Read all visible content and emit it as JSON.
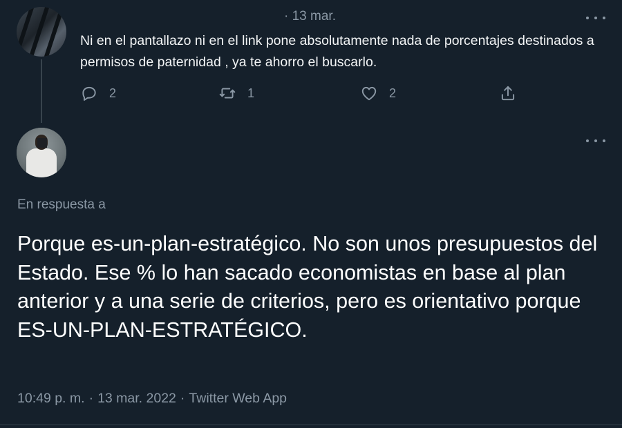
{
  "parent_tweet": {
    "date": "· 13 mar.",
    "text": "Ni en el pantallazo ni en el link pone absolutamente nada de porcentajes destinados a permisos de paternidad , ya te ahorro el buscarlo.",
    "actions": {
      "reply_count": "2",
      "retweet_count": "1",
      "like_count": "2"
    }
  },
  "reply_tweet": {
    "in_reply_to_label": "En respuesta a",
    "text": "Porque es-un-plan-estratégico. No son unos presupuestos del Estado. Ese % lo han sacado economistas en base al plan anterior y a una serie de criterios, pero es orientativo porque ES-UN-PLAN-ESTRATÉGICO.",
    "time": "10:49 p. m.",
    "date": "13 mar. 2022",
    "source": "Twitter Web App",
    "separator": "·"
  },
  "icons": {
    "reply": "reply-bubble-icon",
    "retweet": "retweet-icon",
    "like": "heart-icon",
    "share": "share-icon",
    "more": "more-dots-icon"
  },
  "colors": {
    "background": "#15202b",
    "secondary_text": "#8b98a5",
    "primary_text": "#ffffff",
    "divider": "#38444d"
  }
}
